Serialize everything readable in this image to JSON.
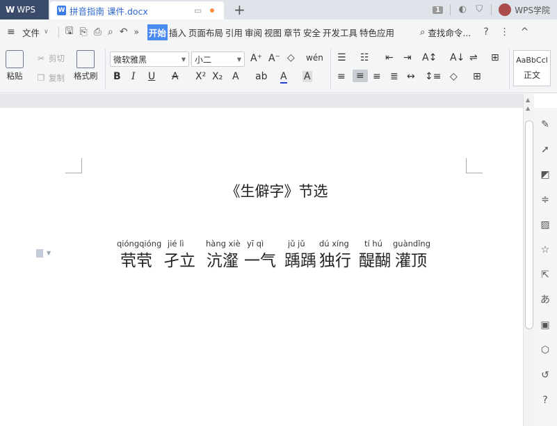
{
  "titlebar": {
    "app_name": "WPS",
    "doc_tab_name": "拼音指南 课件.docx",
    "page_badge": "1",
    "college_label": "WPS学院"
  },
  "menu": {
    "file_label": "文件",
    "tabs": [
      "开始",
      "插入",
      "页面布局",
      "引用",
      "审阅",
      "视图",
      "章节",
      "安全",
      "开发工具",
      "特色应用"
    ],
    "active_tab": "开始",
    "find_label": "查找命令...",
    "help": "?",
    "more": "⋮",
    "collapse": "^"
  },
  "ribbon": {
    "paste_label": "粘贴",
    "cut_label": "剪切",
    "copy_label": "复制",
    "format_painter_label": "格式刷",
    "font_name": "微软雅黑",
    "font_size": "小二",
    "style_preview": "AaBbCcI",
    "style_name": "正文"
  },
  "document": {
    "title": "《生僻字》节选",
    "words": [
      {
        "pinyin": "qióngqióng",
        "hanzi": "茕茕"
      },
      {
        "pinyin": "jié   lì",
        "hanzi": "孑立"
      },
      {
        "pinyin": "hàng xiè",
        "hanzi": "沆瀣"
      },
      {
        "pinyin": "yī   qì",
        "hanzi": "一气"
      },
      {
        "pinyin": "jǔ   jǔ",
        "hanzi": "踽踽"
      },
      {
        "pinyin": "dú xíng",
        "hanzi": "独行"
      },
      {
        "pinyin": "tí   hú",
        "hanzi": "醍醐"
      },
      {
        "pinyin": "guàndǐng",
        "hanzi": "灌顶"
      }
    ]
  }
}
